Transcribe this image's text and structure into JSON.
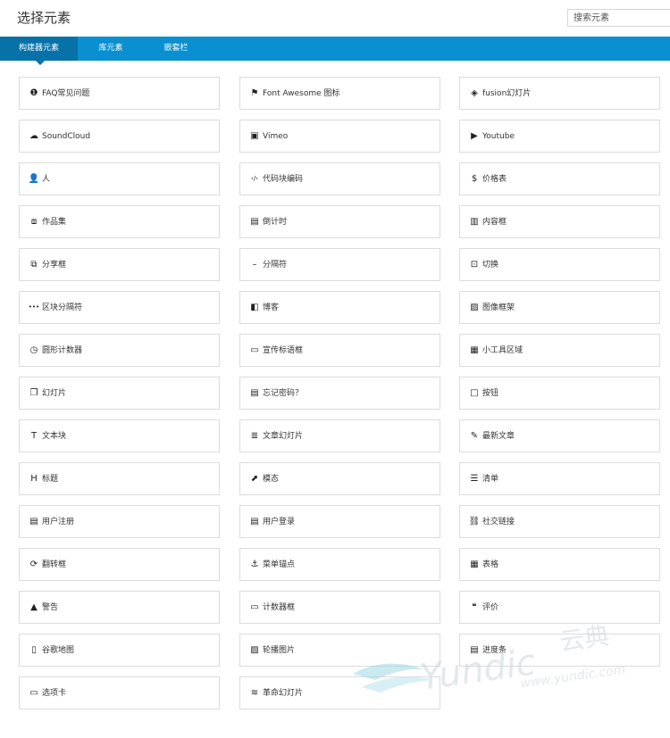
{
  "header": {
    "title": "选择元素",
    "search_placeholder": "搜索元素"
  },
  "tabs": [
    {
      "label": "构建器元素",
      "active": true
    },
    {
      "label": "库元素",
      "active": false
    },
    {
      "label": "嵌套栏",
      "active": false
    }
  ],
  "colors": {
    "tab_bar": "#0a8fd1",
    "tab_active": "#0672a8"
  },
  "elements": [
    {
      "label": "FAQ常见问题",
      "icon": "info-circle-icon",
      "glyph": "❶"
    },
    {
      "label": "Font Awesome 图标",
      "icon": "flag-icon",
      "glyph": "⚑"
    },
    {
      "label": "fusion幻灯片",
      "icon": "layers-icon",
      "glyph": "◈"
    },
    {
      "label": "SoundCloud",
      "icon": "soundcloud-icon",
      "glyph": "☁"
    },
    {
      "label": "Vimeo",
      "icon": "vimeo-icon",
      "glyph": "▣"
    },
    {
      "label": "Youtube",
      "icon": "youtube-icon",
      "glyph": "▶"
    },
    {
      "label": "人",
      "icon": "user-icon",
      "glyph": "👤"
    },
    {
      "label": "代码块编码",
      "icon": "code-icon",
      "glyph": "‹/›"
    },
    {
      "label": "价格表",
      "icon": "dollar-icon",
      "glyph": "$"
    },
    {
      "label": "作品集",
      "icon": "portfolio-icon",
      "glyph": "⧈"
    },
    {
      "label": "倒计时",
      "icon": "calendar-check-icon",
      "glyph": "▤"
    },
    {
      "label": "内容框",
      "icon": "content-box-icon",
      "glyph": "▥"
    },
    {
      "label": "分享框",
      "icon": "share-icon",
      "glyph": "⧉"
    },
    {
      "label": "分隔符",
      "icon": "minus-icon",
      "glyph": "–"
    },
    {
      "label": "切换",
      "icon": "toggle-icon",
      "glyph": "⊡"
    },
    {
      "label": "区块分隔符",
      "icon": "ellipsis-icon",
      "glyph": "•••"
    },
    {
      "label": "博客",
      "icon": "book-icon",
      "glyph": "◧"
    },
    {
      "label": "图像框架",
      "icon": "image-icon",
      "glyph": "▨"
    },
    {
      "label": "圆形计数器",
      "icon": "clock-icon",
      "glyph": "◷"
    },
    {
      "label": "宣传标语框",
      "icon": "banner-icon",
      "glyph": "▭"
    },
    {
      "label": "小工具区域",
      "icon": "widget-icon",
      "glyph": "▦"
    },
    {
      "label": "幻灯片",
      "icon": "slides-icon",
      "glyph": "❐"
    },
    {
      "label": "忘记密码？",
      "icon": "calendar-icon",
      "glyph": "▤"
    },
    {
      "label": "按钮",
      "icon": "square-icon",
      "glyph": "□"
    },
    {
      "label": "文本块",
      "icon": "text-icon",
      "glyph": "T"
    },
    {
      "label": "文章幻灯片",
      "icon": "stack-icon",
      "glyph": "≣"
    },
    {
      "label": "最新文章",
      "icon": "feather-icon",
      "glyph": "✎"
    },
    {
      "label": "标题",
      "icon": "heading-icon",
      "glyph": "H"
    },
    {
      "label": "模态",
      "icon": "external-link-icon",
      "glyph": "⬈"
    },
    {
      "label": "清单",
      "icon": "list-icon",
      "glyph": "☰"
    },
    {
      "label": "用户注册",
      "icon": "calendar-icon",
      "glyph": "▤"
    },
    {
      "label": "用户登录",
      "icon": "calendar-icon",
      "glyph": "▤"
    },
    {
      "label": "社交链接",
      "icon": "link-icon",
      "glyph": "⛓"
    },
    {
      "label": "翻转框",
      "icon": "refresh-icon",
      "glyph": "⟳"
    },
    {
      "label": "菜单锚点",
      "icon": "anchor-icon",
      "glyph": "⚓"
    },
    {
      "label": "表格",
      "icon": "table-icon",
      "glyph": "▦"
    },
    {
      "label": "警告",
      "icon": "warning-icon",
      "glyph": "▲"
    },
    {
      "label": "计数器框",
      "icon": "counter-box-icon",
      "glyph": "▭"
    },
    {
      "label": "评价",
      "icon": "comments-icon",
      "glyph": "❝"
    },
    {
      "label": "谷歌地图",
      "icon": "map-icon",
      "glyph": "▯"
    },
    {
      "label": "轮播图片",
      "icon": "carousel-icon",
      "glyph": "▨"
    },
    {
      "label": "进度条",
      "icon": "progress-bar-icon",
      "glyph": "▤"
    },
    {
      "label": "选项卡",
      "icon": "folder-icon",
      "glyph": "▭"
    },
    {
      "label": "革命幻灯片",
      "icon": "revolution-icon",
      "glyph": "≋"
    }
  ],
  "watermark": {
    "brand": "Yundic",
    "brand_cn": "云典",
    "url": "www.yundic.com"
  }
}
